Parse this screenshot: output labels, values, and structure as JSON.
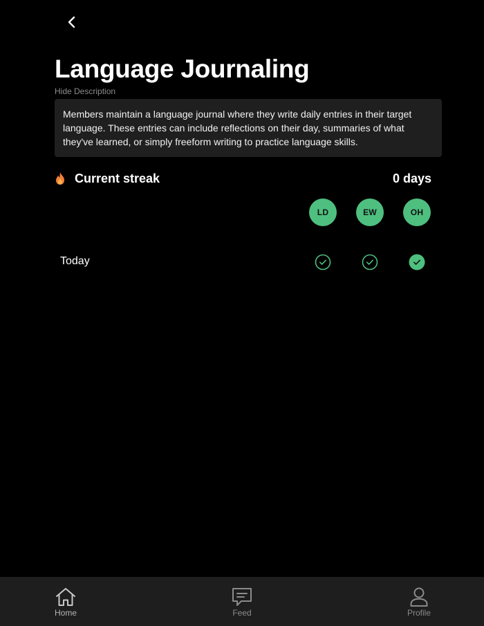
{
  "header": {
    "back_icon": "chevron-left-icon",
    "title": "Language Journaling",
    "hide_description_label": "Hide Description",
    "description": "Members maintain a language journal where they write daily entries in their target language. These entries can include reflections on their day, summaries of what they've learned, or simply freeform writing to practice language skills."
  },
  "streak": {
    "icon": "flame-icon",
    "label": "Current streak",
    "value": "0 days"
  },
  "members": [
    {
      "initials": "LD"
    },
    {
      "initials": "EW"
    },
    {
      "initials": "OH"
    }
  ],
  "days": [
    {
      "label": "Today",
      "checks": [
        {
          "member": "LD",
          "state": "outline"
        },
        {
          "member": "EW",
          "state": "outline"
        },
        {
          "member": "OH",
          "state": "filled"
        }
      ]
    }
  ],
  "bottom_nav": {
    "items": [
      {
        "label": "Home",
        "icon": "home-icon",
        "active": true
      },
      {
        "label": "Feed",
        "icon": "chat-icon",
        "active": false
      },
      {
        "label": "Profile",
        "icon": "user-icon",
        "active": false
      }
    ]
  },
  "colors": {
    "background": "#000000",
    "accent_green": "#4ebf7f",
    "card_bg": "#1f1f1f",
    "nav_bg": "#1e1e1e",
    "flame": "#f0803c"
  }
}
